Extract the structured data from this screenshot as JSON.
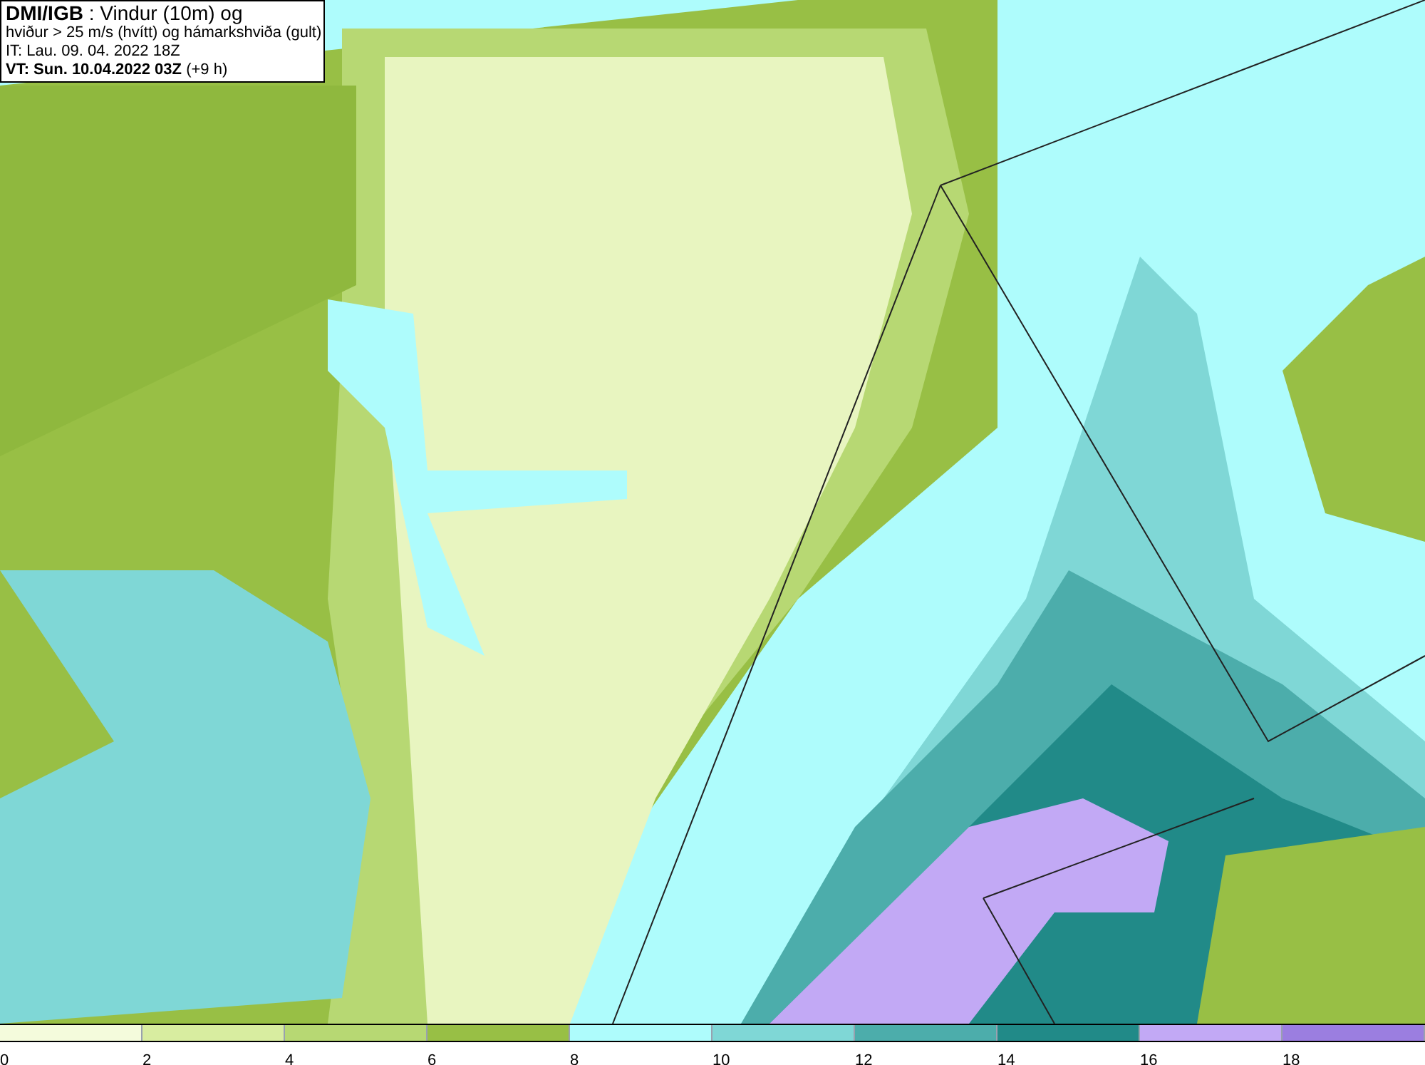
{
  "info_box": {
    "lines": [
      "**DMI/IGB** : Vindur (10m) og",
      "hviður > 25 m/s (hvítt) og hámarkshviða (gult)",
      "IT: Lau. 09. 04. 2022 18Z",
      "**VT: Sun. 10.04.2022 03Z** (+9 h)"
    ]
  },
  "legend": {
    "items": [
      {
        "label": "0",
        "color": "#f4fbdc"
      },
      {
        "label": "2",
        "color": "#d8eda0"
      },
      {
        "label": "4",
        "color": "#b7d873"
      },
      {
        "label": "6",
        "color": "#98bf45"
      },
      {
        "label": "8",
        "color": "#aefcfc"
      },
      {
        "label": "10",
        "color": "#7fd7d6"
      },
      {
        "label": "12",
        "color": "#4cadab"
      },
      {
        "label": "14",
        "color": "#218a88"
      },
      {
        "label": "16",
        "color": "#c2a9f5"
      },
      {
        "label": "18",
        "color": "#9b7ee0"
      }
    ]
  }
}
